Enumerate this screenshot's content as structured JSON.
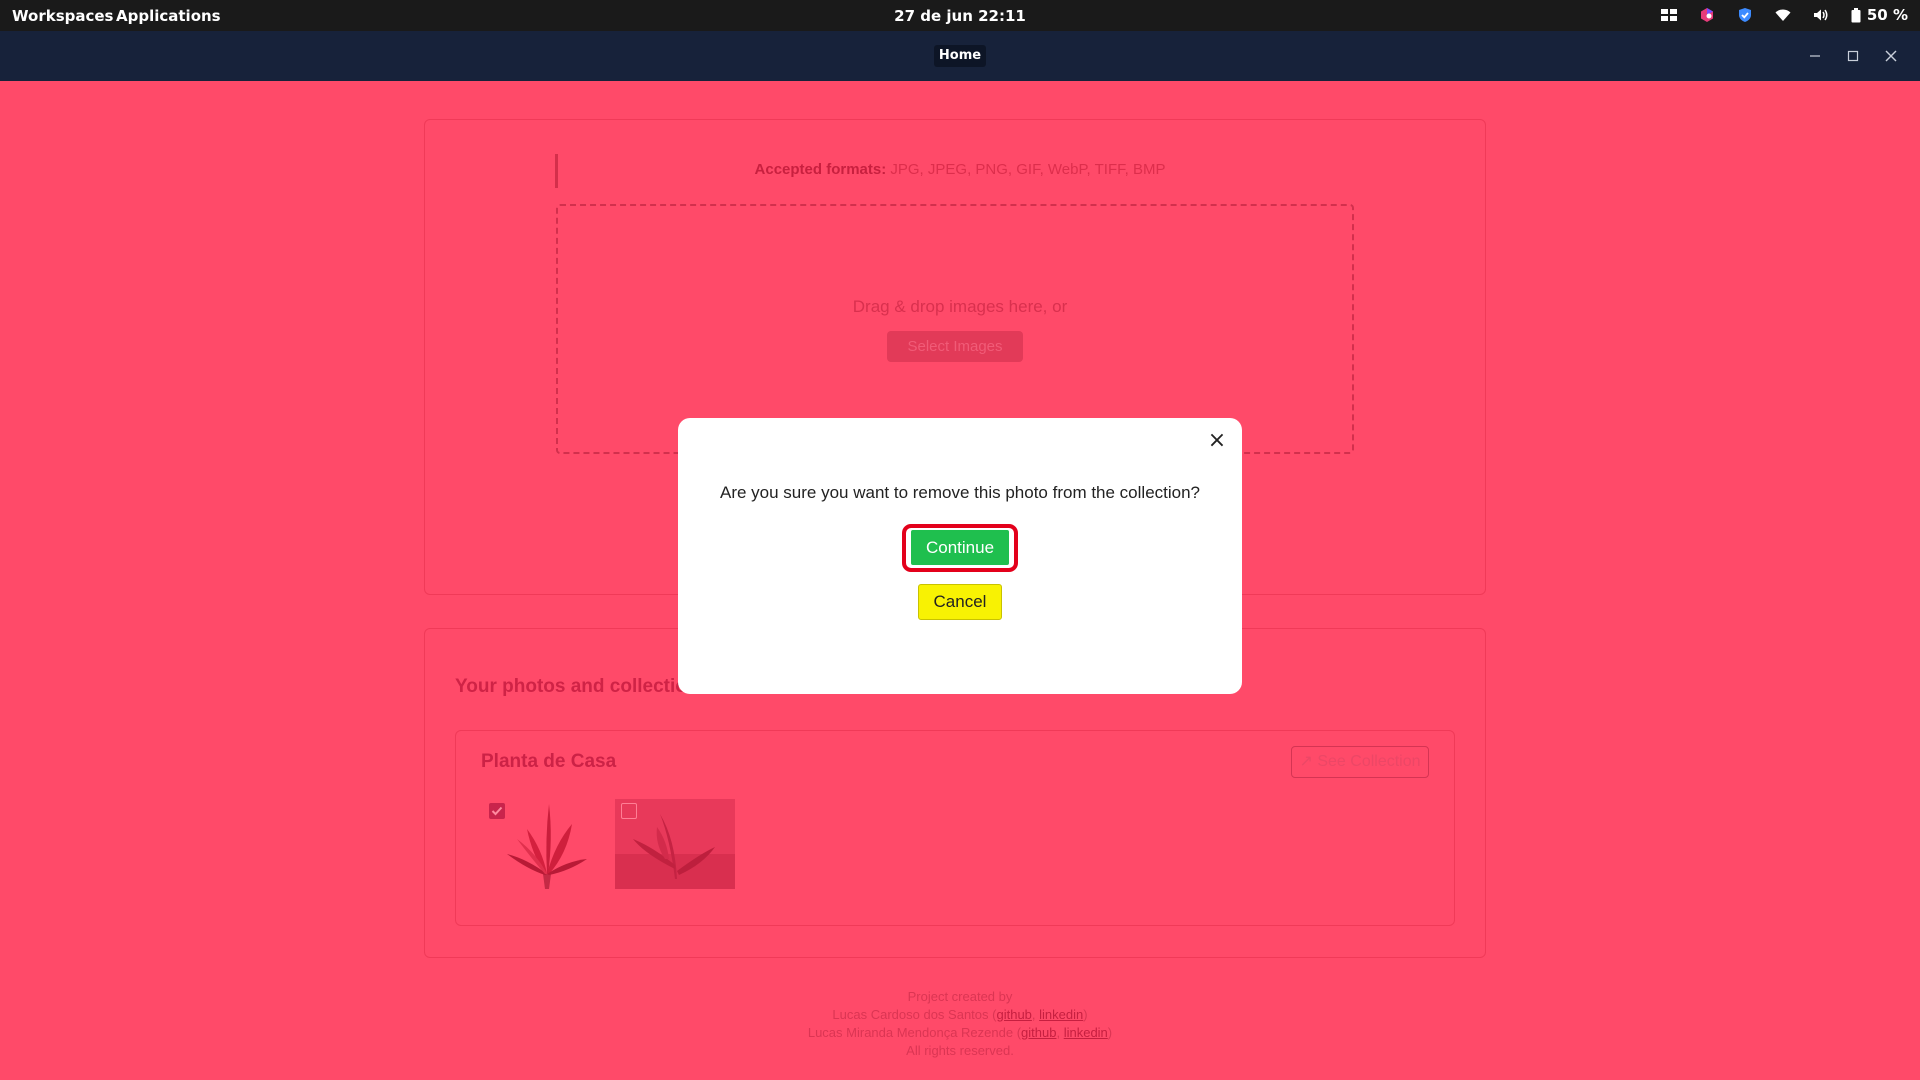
{
  "system_bar": {
    "workspaces": "Workspaces",
    "applications": "Applications",
    "datetime": "27 de jun  22:11",
    "battery": "50 %"
  },
  "window": {
    "tab_title": "Home"
  },
  "upload": {
    "formats_label": "Accepted formats:",
    "formats_value": " JPG, JPEG, PNG, GIF, WebP, TIFF, BMP",
    "drop_text": "Drag & drop images here, or",
    "select_button": "Select Images"
  },
  "photos": {
    "section_title": "Your photos and collections",
    "collection_name": "Planta de Casa",
    "see_collection": "See Collection",
    "photo1_checked": true,
    "photo2_checked": false
  },
  "footer": {
    "line1": "Project created by",
    "author1": "Lucas Cardoso dos Santos",
    "author2": "Lucas Miranda Mendonça Rezende",
    "github": "github",
    "linkedin": "linkedin",
    "rights": "All rights reserved."
  },
  "modal": {
    "close_glyph": "×",
    "message": "Are you sure you want to remove this photo from the collection?",
    "continue": "Continue",
    "cancel": "Cancel"
  },
  "colors": {
    "overlay": "#ff4a69",
    "continue_bg": "#1fbf4e",
    "cancel_bg": "#f8f203",
    "highlight_ring": "#e3001b"
  }
}
